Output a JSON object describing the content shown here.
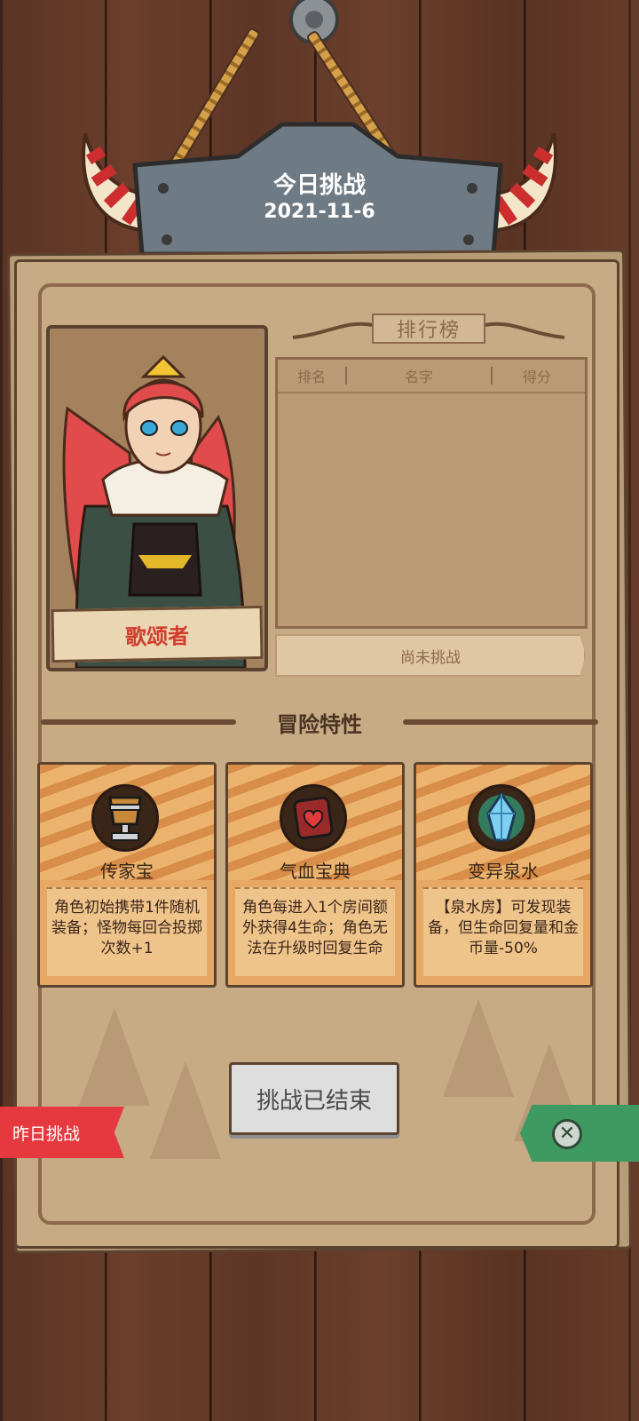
{
  "sign": {
    "title": "今日挑战",
    "date": "2021-11-6"
  },
  "hero": {
    "name": "歌颂者"
  },
  "ranking": {
    "title": "排行榜",
    "columns": [
      "排名",
      "名字",
      "得分"
    ],
    "status": "尚未挑战"
  },
  "traits": {
    "title": "冒险特性",
    "cards": [
      {
        "name": "传家宝",
        "desc": "角色初始携带1件随机装备；怪物每回合投掷次数+1",
        "icon": "treasure-goblet-icon"
      },
      {
        "name": "气血宝典",
        "desc": "角色每进入1个房间额外获得4生命；角色无法在升级时回复生命",
        "icon": "heart-book-icon"
      },
      {
        "name": "变异泉水",
        "desc": "【泉水房】可发现装备，但生命回复量和金币量-50%",
        "icon": "blue-crystal-icon"
      }
    ]
  },
  "buttons": {
    "end": "挑战已结束",
    "yesterday": "昨日挑战",
    "close": "close-icon"
  }
}
